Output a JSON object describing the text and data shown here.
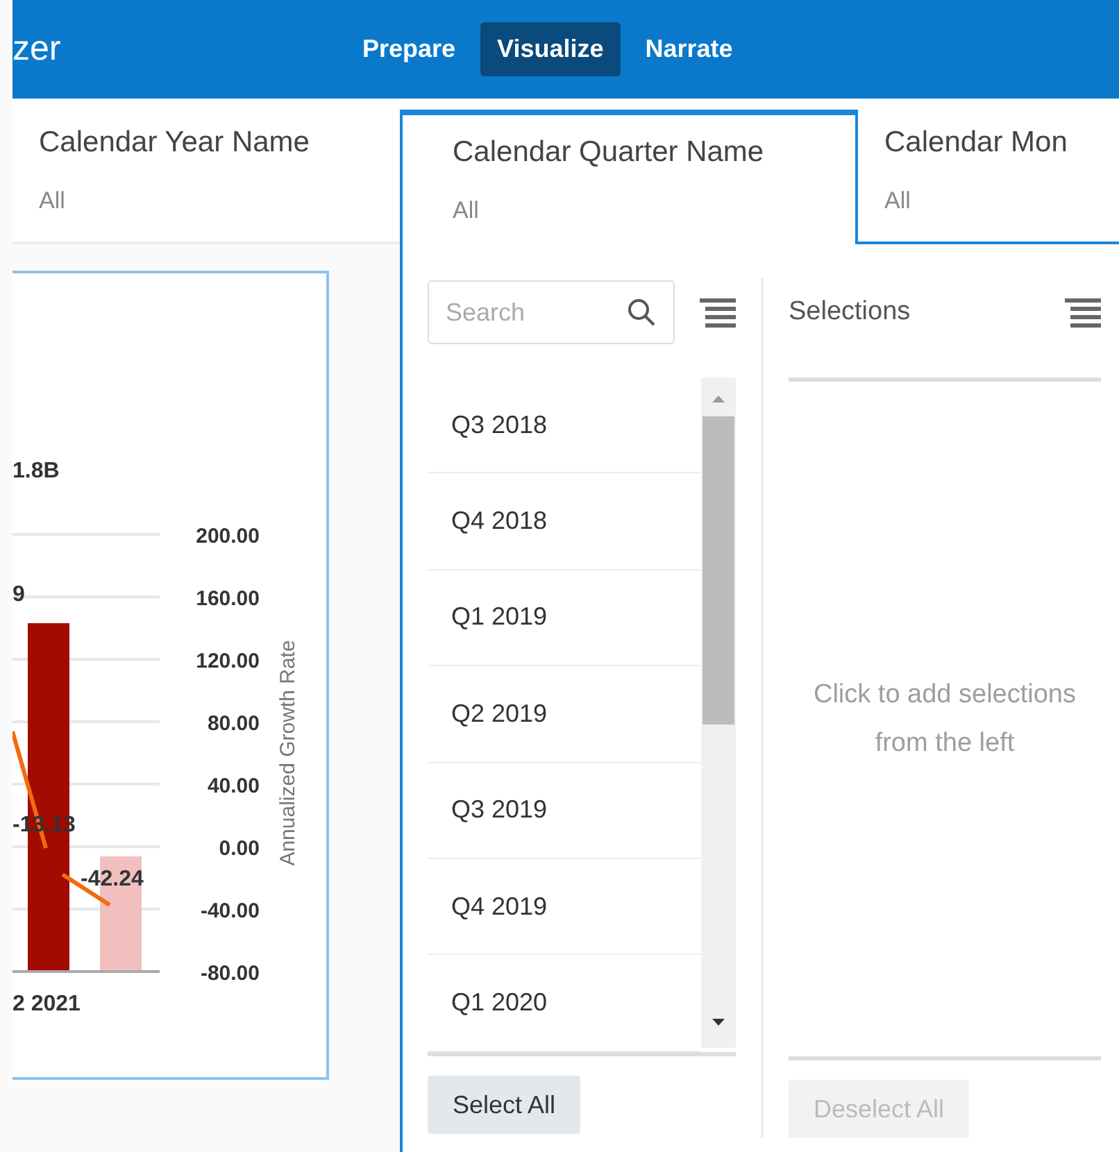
{
  "app_title": "zer",
  "nav": [
    {
      "label": "Prepare",
      "selected": false
    },
    {
      "label": "Visualize",
      "selected": true
    },
    {
      "label": "Narrate",
      "selected": false
    }
  ],
  "filters": [
    {
      "name": "Calendar Year Name",
      "value": "All",
      "selected": false
    },
    {
      "name": "Calendar Quarter Name",
      "value": "All",
      "selected": true
    },
    {
      "name": "Calendar Mon",
      "value": "All",
      "selected": false
    }
  ],
  "chart": {
    "axis_title": "Annualized Growth Rate",
    "category_label": "2 2021",
    "ticks": [
      "200.00",
      "160.00",
      "120.00",
      "80.00",
      "40.00",
      "0.00",
      "-40.00",
      "-80.00"
    ],
    "data_labels": [
      "1.8B",
      "9",
      "-13.13",
      "-42.24"
    ]
  },
  "filter_panel": {
    "search": {
      "placeholder": "Search"
    },
    "items": [
      "Q3 2018",
      "Q4 2018",
      "Q1 2019",
      "Q2 2019",
      "Q3 2019",
      "Q4 2019",
      "Q1 2020"
    ],
    "select_all": "Select All",
    "selections_title": "Selections",
    "empty_hint": "Click to add selections from the left",
    "deselect_all": {
      "label": "Deselect All",
      "disabled": true
    }
  }
}
